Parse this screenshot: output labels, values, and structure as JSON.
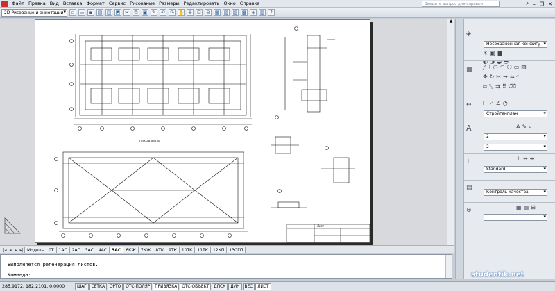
{
  "menubar": {
    "items": [
      "Файл",
      "Правка",
      "Вид",
      "Вставка",
      "Формат",
      "Сервис",
      "Рисование",
      "Размеры",
      "Редактировать",
      "Окно",
      "Справка"
    ],
    "help_placeholder": "Введите вопрос для справки"
  },
  "toolbar": {
    "workspace": "2D Рисование и аннотации"
  },
  "drawing": {
    "top_plan_label": "ПЛАН КРОВЛИ",
    "title_block_label": "Лист"
  },
  "tabs": [
    "Модель",
    "0Т",
    "1АС",
    "2АС",
    "3АС",
    "4АС",
    "5АС",
    "6КЖ",
    "7КЖ",
    "8ТК",
    "9ТК",
    "10ТК",
    "11ТК",
    "12КП",
    "13СГП"
  ],
  "active_tab": "Модель",
  "command": {
    "line1": "Выполняется регенерация листов.",
    "line2": "Команда:"
  },
  "status": {
    "coords": "285.9172, 182.2101, 0.0000",
    "buttons": [
      "ШАГ",
      "СЕТКА",
      "ОРТО",
      "ОТС-ПОЛЯР",
      "ПРИВЯЗКА",
      "ОТС-ОБЪЕКТ",
      "ДПСК",
      "ДИН",
      "ВЕС",
      "ЛИСТ"
    ]
  },
  "panel": {
    "layer_state": "Несохраненная конфигу",
    "text_style": "Стройгенплан",
    "text_height_1": "2",
    "text_height_2": "2",
    "dim_style": "Standard",
    "mleader_style": "Контроль качества",
    "empty_select": ""
  },
  "watermark": "studentik.net",
  "colors": {
    "accent": "#2f5f9a",
    "logo": "#c8302c"
  }
}
